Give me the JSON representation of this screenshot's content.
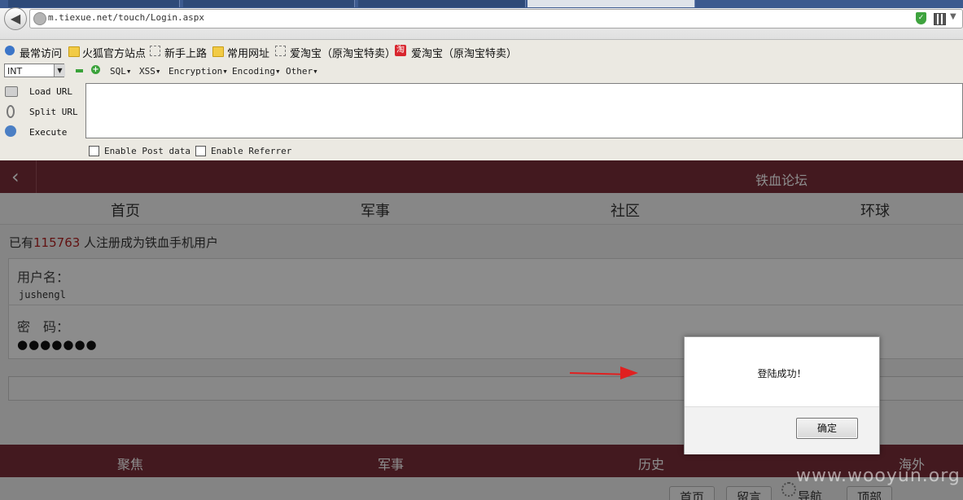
{
  "browser": {
    "url": "m.tiexue.net/touch/Login.aspx"
  },
  "bookmarks": [
    {
      "label": "最常访问",
      "icon": "search-icon"
    },
    {
      "label": "火狐官方站点",
      "icon": "folder-icon"
    },
    {
      "label": "新手上路",
      "icon": "bookmark-icon"
    },
    {
      "label": "常用网址",
      "icon": "folder-icon"
    },
    {
      "label": "爱淘宝（原淘宝特卖）",
      "icon": "bookmark-icon"
    },
    {
      "label": "爱淘宝（原淘宝特卖）",
      "icon": "taobao-icon"
    }
  ],
  "hackbar": {
    "select_value": "INT",
    "menus": [
      "SQL▾",
      "XSS▾",
      "Encryption▾",
      "Encoding▾",
      "Other▾"
    ],
    "actions": [
      "Load URL",
      "Split URL",
      "Execute"
    ],
    "checkboxes": [
      "Enable Post data",
      "Enable Referrer"
    ]
  },
  "site": {
    "title": "铁血论坛",
    "nav": [
      "首页",
      "军事",
      "社区",
      "环球"
    ],
    "reg_prefix": "已有",
    "reg_count": "115763",
    "reg_suffix": " 人注册成为铁血手机用户",
    "username_label": "用户名：",
    "username_value": "jushengl",
    "password_label": "密　码：",
    "password_value": "●●●●●●●",
    "footer": [
      "聚焦",
      "军事",
      "历史",
      "海外"
    ],
    "bottom_buttons": [
      "首页",
      "留言",
      "导航",
      "顶部"
    ]
  },
  "dialog": {
    "message": "登陆成功！",
    "ok_label": "确定"
  },
  "watermark": "www.wooyun.org"
}
